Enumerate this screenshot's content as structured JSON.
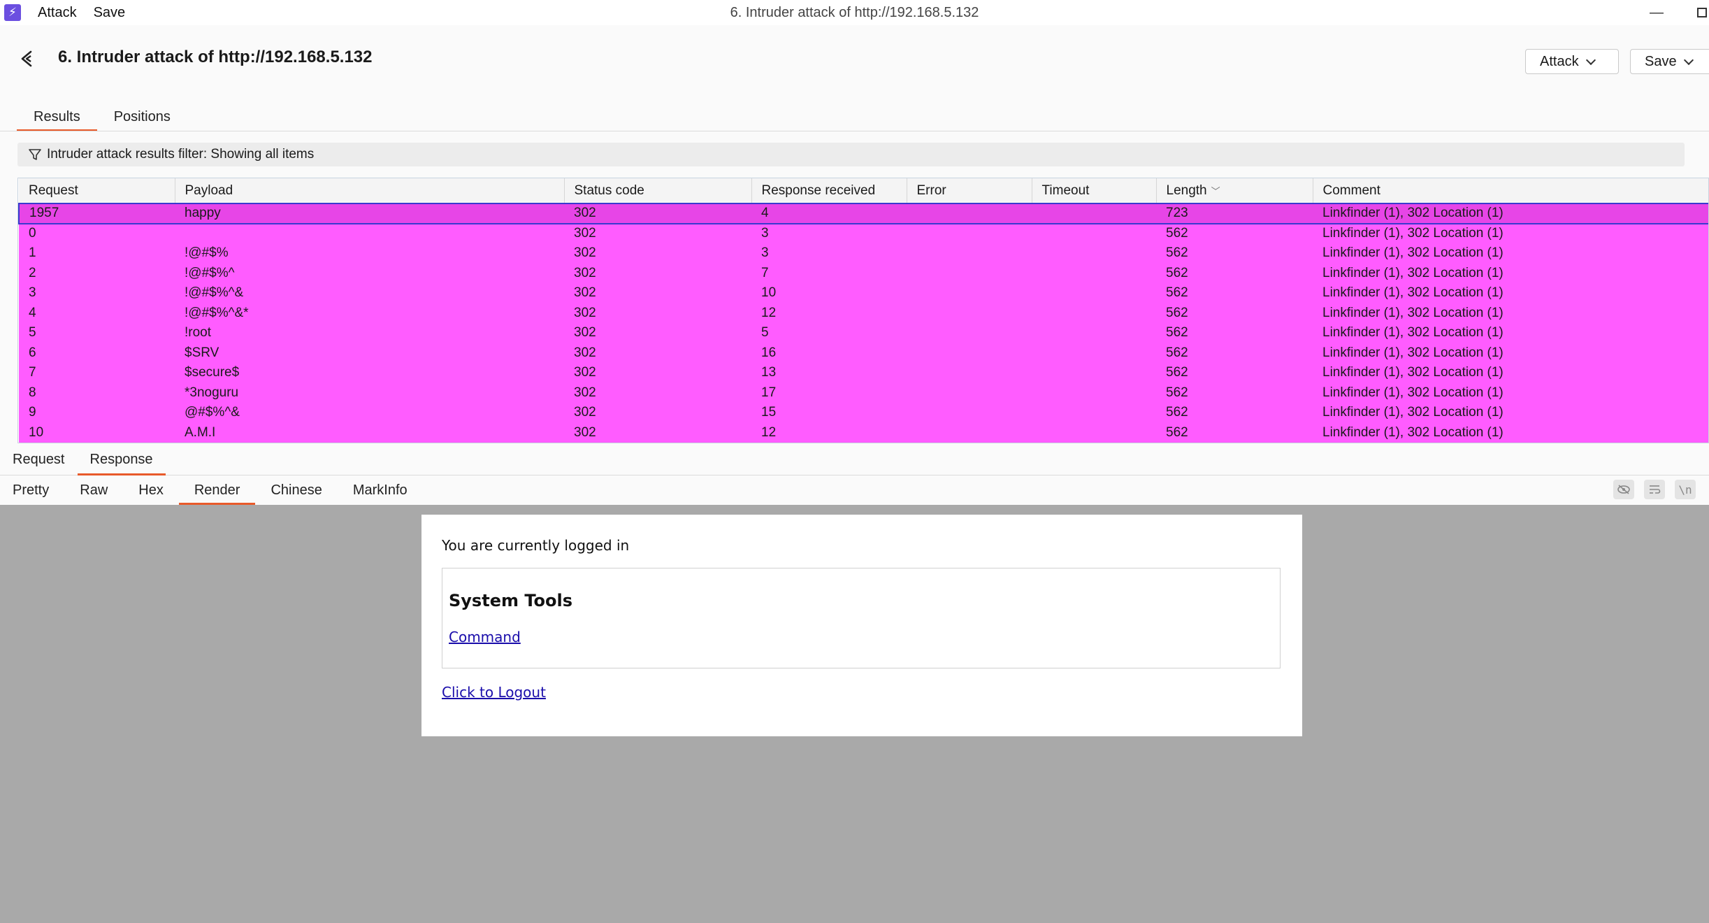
{
  "window": {
    "menu": [
      "Attack",
      "Save"
    ],
    "title": "6. Intruder attack of http://192.168.5.132",
    "minimize": "—"
  },
  "header": {
    "title": "6. Intruder attack of http://192.168.5.132",
    "attack_btn": "Attack",
    "save_btn": "Save"
  },
  "main_tabs": [
    "Results",
    "Positions"
  ],
  "filter": {
    "text": "Intruder attack results filter: Showing all items"
  },
  "table": {
    "columns": [
      "Request",
      "Payload",
      "Status code",
      "Response received",
      "Error",
      "Timeout",
      "Length",
      "Comment"
    ],
    "rows": [
      [
        "1957",
        "happy",
        "302",
        "4",
        "",
        "",
        "723",
        "Linkfinder (1), 302 Location (1)"
      ],
      [
        "0",
        "",
        "302",
        "3",
        "",
        "",
        "562",
        "Linkfinder (1), 302 Location (1)"
      ],
      [
        "1",
        "!@#$%",
        "302",
        "3",
        "",
        "",
        "562",
        "Linkfinder (1), 302 Location (1)"
      ],
      [
        "2",
        "!@#$%^",
        "302",
        "7",
        "",
        "",
        "562",
        "Linkfinder (1), 302 Location (1)"
      ],
      [
        "3",
        "!@#$%^&",
        "302",
        "10",
        "",
        "",
        "562",
        "Linkfinder (1), 302 Location (1)"
      ],
      [
        "4",
        "!@#$%^&*",
        "302",
        "12",
        "",
        "",
        "562",
        "Linkfinder (1), 302 Location (1)"
      ],
      [
        "5",
        "!root",
        "302",
        "5",
        "",
        "",
        "562",
        "Linkfinder (1), 302 Location (1)"
      ],
      [
        "6",
        "$SRV",
        "302",
        "16",
        "",
        "",
        "562",
        "Linkfinder (1), 302 Location (1)"
      ],
      [
        "7",
        "$secure$",
        "302",
        "13",
        "",
        "",
        "562",
        "Linkfinder (1), 302 Location (1)"
      ],
      [
        "8",
        "*3noguru",
        "302",
        "17",
        "",
        "",
        "562",
        "Linkfinder (1), 302 Location (1)"
      ],
      [
        "9",
        "@#$%^&",
        "302",
        "15",
        "",
        "",
        "562",
        "Linkfinder (1), 302 Location (1)"
      ],
      [
        "10",
        "A.M.I",
        "302",
        "12",
        "",
        "",
        "562",
        "Linkfinder (1), 302 Location (1)"
      ]
    ],
    "highlight_color": "#ff5cff"
  },
  "sub_tabs": [
    "Request",
    "Response"
  ],
  "view_tabs": [
    "Pretty",
    "Raw",
    "Hex",
    "Render",
    "Chinese",
    "MarkInfo"
  ],
  "view_tools": [
    "\\n"
  ],
  "render": {
    "logged_in": "You are currently logged in",
    "tools_title": "System Tools",
    "command_link": "Command",
    "logout_link": "Click to Logout"
  }
}
